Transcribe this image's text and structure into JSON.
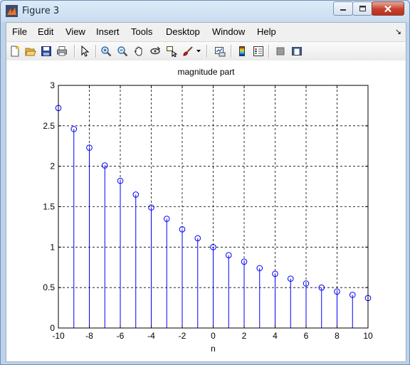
{
  "window": {
    "title": "Figure 3"
  },
  "menu": [
    "File",
    "Edit",
    "View",
    "Insert",
    "Tools",
    "Desktop",
    "Window",
    "Help"
  ],
  "toolbar": {
    "buttons": [
      {
        "name": "new-figure-icon"
      },
      {
        "name": "open-file-icon"
      },
      {
        "name": "save-icon"
      },
      {
        "name": "print-icon"
      },
      {
        "name": "edit-plot-pointer-icon"
      },
      {
        "name": "zoom-in-icon"
      },
      {
        "name": "zoom-out-icon"
      },
      {
        "name": "pan-hand-icon"
      },
      {
        "name": "rotate-3d-icon"
      },
      {
        "name": "data-cursor-icon"
      },
      {
        "name": "brush-icon"
      },
      {
        "name": "link-plot-icon"
      },
      {
        "name": "colorbar-icon"
      },
      {
        "name": "legend-icon"
      },
      {
        "name": "hide-plot-tools-icon"
      },
      {
        "name": "show-plot-tools-icon"
      }
    ]
  },
  "chart_data": {
    "type": "stem",
    "title": "magnitude part",
    "xlabel": "n",
    "ylabel": "",
    "xlim": [
      -10,
      10
    ],
    "ylim": [
      0,
      3
    ],
    "xticks": [
      "-10",
      "-8",
      "-6",
      "-4",
      "-2",
      "0",
      "2",
      "4",
      "6",
      "8",
      "10"
    ],
    "yticks": [
      "0",
      "0.5",
      "1",
      "1.5",
      "2",
      "2.5",
      "3"
    ],
    "grid": true,
    "color": "#0000ff",
    "x": [
      -10,
      -9,
      -8,
      -7,
      -6,
      -5,
      -4,
      -3,
      -2,
      -1,
      0,
      1,
      2,
      3,
      4,
      5,
      6,
      7,
      8,
      9,
      10
    ],
    "y": [
      2.72,
      2.46,
      2.23,
      2.01,
      1.82,
      1.65,
      1.49,
      1.35,
      1.22,
      1.11,
      1.0,
      0.9,
      0.82,
      0.74,
      0.67,
      0.61,
      0.55,
      0.5,
      0.45,
      0.41,
      0.37
    ]
  }
}
